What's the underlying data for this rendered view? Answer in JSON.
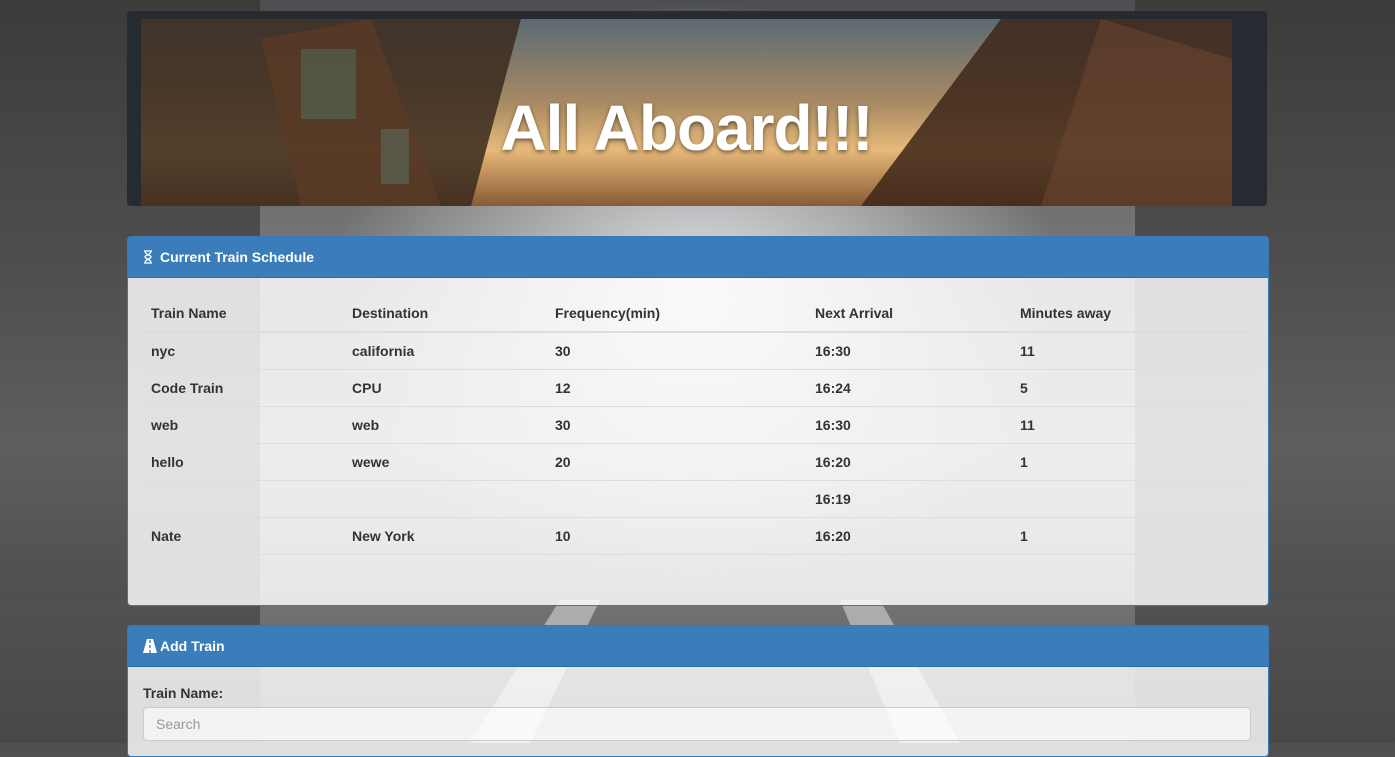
{
  "header": {
    "title": "All Aboard!!!"
  },
  "schedule": {
    "heading": "Current Train Schedule",
    "heading_icon": "hourglass-icon",
    "columns": [
      "Train Name",
      "Destination",
      "Frequency(min)",
      "Next Arrival",
      "Minutes away"
    ],
    "rows": [
      [
        "nyc",
        "california",
        "30",
        "16:30",
        "11"
      ],
      [
        "Code Train",
        "CPU",
        "12",
        "16:24",
        "5"
      ],
      [
        "web",
        "web",
        "30",
        "16:30",
        "11"
      ],
      [
        "hello",
        "wewe",
        "20",
        "16:20",
        "1"
      ],
      [
        "",
        "",
        "",
        "16:19",
        ""
      ],
      [
        "Nate",
        "New York",
        "10",
        "16:20",
        "1"
      ]
    ]
  },
  "add_train": {
    "heading": "Add Train",
    "heading_icon": "road-icon",
    "train_name_label": "Train Name:",
    "train_name_placeholder": "Search",
    "train_name_value": ""
  },
  "colors": {
    "panel_heading": "#3a7dba",
    "jumbotron": "#262a31"
  }
}
